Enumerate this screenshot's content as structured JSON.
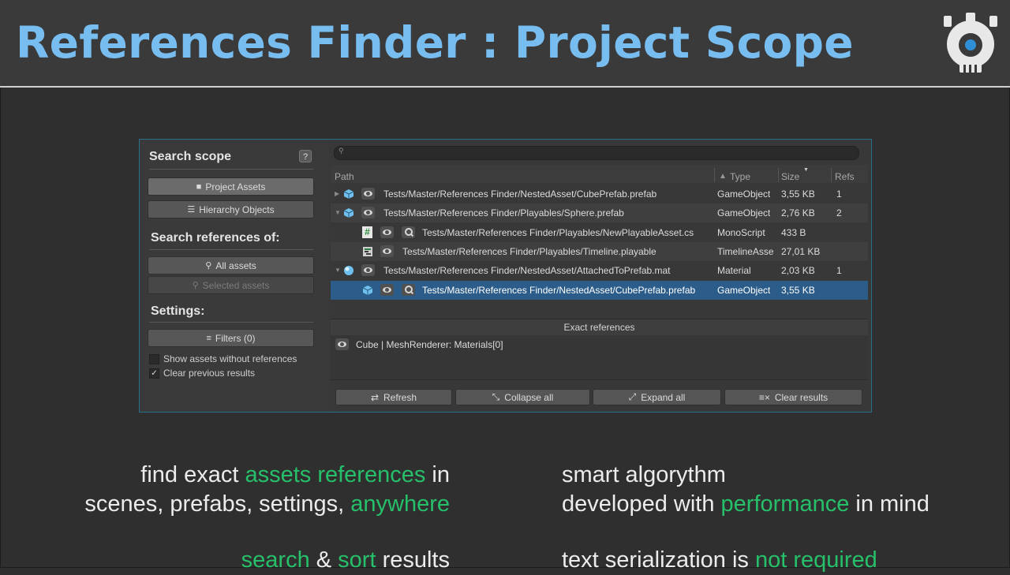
{
  "slide": {
    "title": "References Finder : Project Scope"
  },
  "left_panel": {
    "search_scope_title": "Search scope",
    "help_icon_glyph": "?",
    "project_assets_label": "Project Assets",
    "hierarchy_objects_label": "Hierarchy Objects",
    "search_refs_title": "Search references of:",
    "all_assets_label": "All assets",
    "selected_assets_label": "Selected assets",
    "settings_title": "Settings:",
    "filters_label": "Filters (0)",
    "show_without_refs_label": "Show assets without references",
    "clear_previous_label": "Clear previous results"
  },
  "table": {
    "headers": {
      "path": "Path",
      "type": "Type",
      "size": "Size",
      "refs": "Refs"
    },
    "rows": [
      {
        "path": "Tests/Master/References Finder/NestedAsset/CubePrefab.prefab",
        "type": "GameObject",
        "size": "3,55 KB",
        "refs": "1",
        "icon": "prefab-cube-icon"
      },
      {
        "path": "Tests/Master/References Finder/Playables/Sphere.prefab",
        "type": "GameObject",
        "size": "2,76 KB",
        "refs": "2",
        "icon": "prefab-cube-icon"
      },
      {
        "path": "Tests/Master/References Finder/Playables/NewPlayableAsset.cs",
        "type": "MonoScript",
        "size": "433 B",
        "refs": "",
        "icon": "script-hash-icon"
      },
      {
        "path": "Tests/Master/References Finder/Playables/Timeline.playable",
        "type": "TimelineAsse",
        "size": "27,01 KB",
        "refs": "",
        "icon": "timeline-icon"
      },
      {
        "path": "Tests/Master/References Finder/NestedAsset/AttachedToPrefab.mat",
        "type": "Material",
        "size": "2,03 KB",
        "refs": "1",
        "icon": "material-sphere-icon"
      },
      {
        "path": "Tests/Master/References Finder/NestedAsset/CubePrefab.prefab",
        "type": "GameObject",
        "size": "3,55 KB",
        "refs": "",
        "icon": "prefab-cube-icon"
      }
    ]
  },
  "exact_refs": {
    "header": "Exact references",
    "items": [
      "Cube | MeshRenderer: Materials[0]"
    ]
  },
  "bottom_buttons": {
    "refresh": "Refresh",
    "collapse_all": "Collapse all",
    "expand_all": "Expand all",
    "clear_results": "Clear results"
  },
  "features": {
    "left1_a": "find exact ",
    "left1_hl": "assets references",
    "left1_b": " in",
    "left2_a": "scenes, prefabs, settings, ",
    "left2_hl": "anywhere",
    "right1": "smart algorythm",
    "right2_a": "developed with ",
    "right2_hl": "performance",
    "right2_b": " in mind",
    "left3_hl1": "search",
    "left3_a": " & ",
    "left3_hl2": "sort",
    "left3_b": " results",
    "right3_a": "text serialization is ",
    "right3_hl": "not required"
  },
  "colors": {
    "title": "#78bdf0",
    "highlight": "#27c06a",
    "selection": "#2c5d8a",
    "prefab_icon": "#6fc0ee"
  }
}
